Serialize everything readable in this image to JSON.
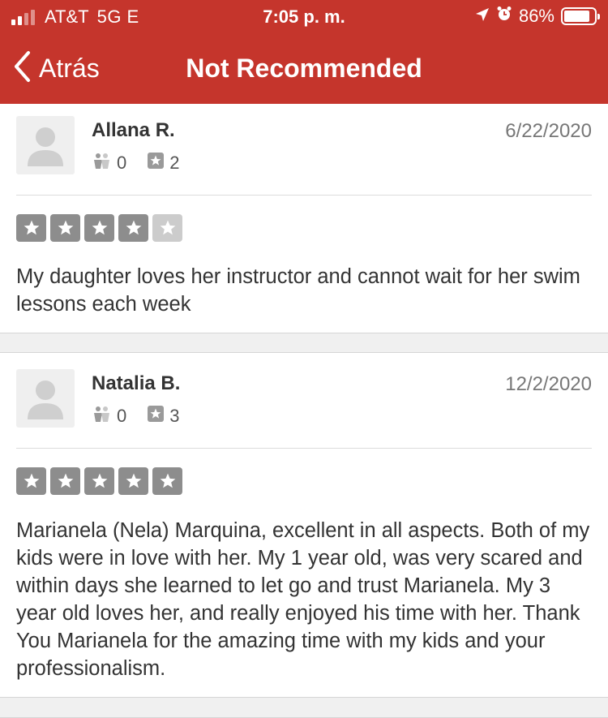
{
  "status_bar": {
    "carrier": "AT&T",
    "network": "5G E",
    "time": "7:05 p. m.",
    "battery": "86%",
    "battery_level": 0.86
  },
  "nav": {
    "back_label": "Atrás",
    "title": "Not Recommended"
  },
  "reviews": [
    {
      "name": "Allana R.",
      "date": "6/22/2020",
      "friends": "0",
      "reviews_count": "2",
      "rating": 4,
      "text": "My daughter loves her instructor and cannot wait for her swim lessons each week"
    },
    {
      "name": "Natalia B.",
      "date": "12/2/2020",
      "friends": "0",
      "reviews_count": "3",
      "rating": 5,
      "text": "Marianela (Nela)  Marquina, excellent in all aspects. Both of my kids were in love with her. My 1 year old, was very scared and within days she learned to let go and trust Marianela. My 3 year old loves her, and really enjoyed his time with her. Thank You Marianela for the amazing time with my kids and your professionalism."
    }
  ]
}
